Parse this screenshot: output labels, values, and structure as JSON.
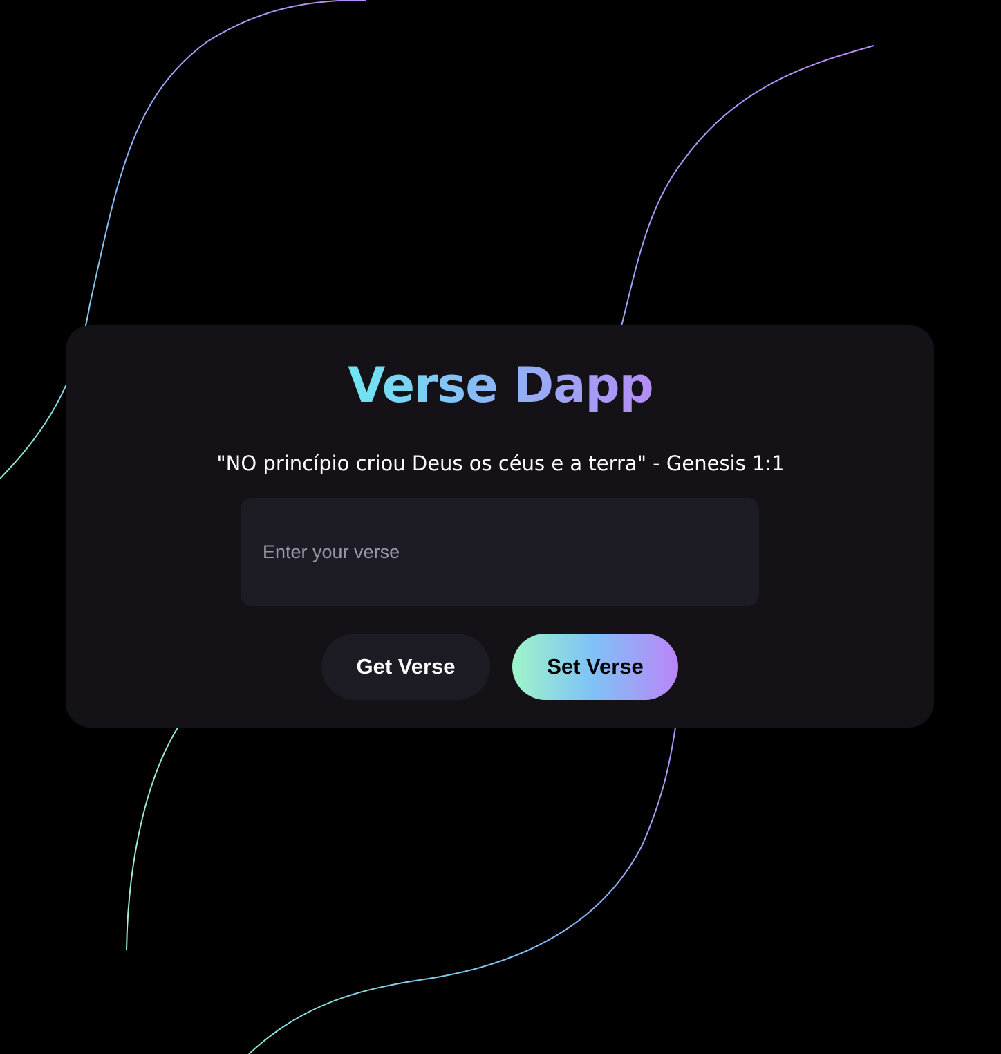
{
  "app": {
    "title": "Verse Dapp",
    "current_verse": "\"NO princípio criou Deus os céus e a terra\" - Genesis 1:1"
  },
  "form": {
    "verse_input_value": "",
    "verse_input_placeholder": "Enter your verse"
  },
  "actions": {
    "get_label": "Get Verse",
    "set_label": "Set Verse"
  },
  "theme": {
    "background": "#000000",
    "card": "#141217",
    "field": "#1d1b24",
    "accent_mint": "#9ef5c9",
    "accent_blue": "#7ec2f6",
    "accent_violet": "#bb85f7"
  }
}
